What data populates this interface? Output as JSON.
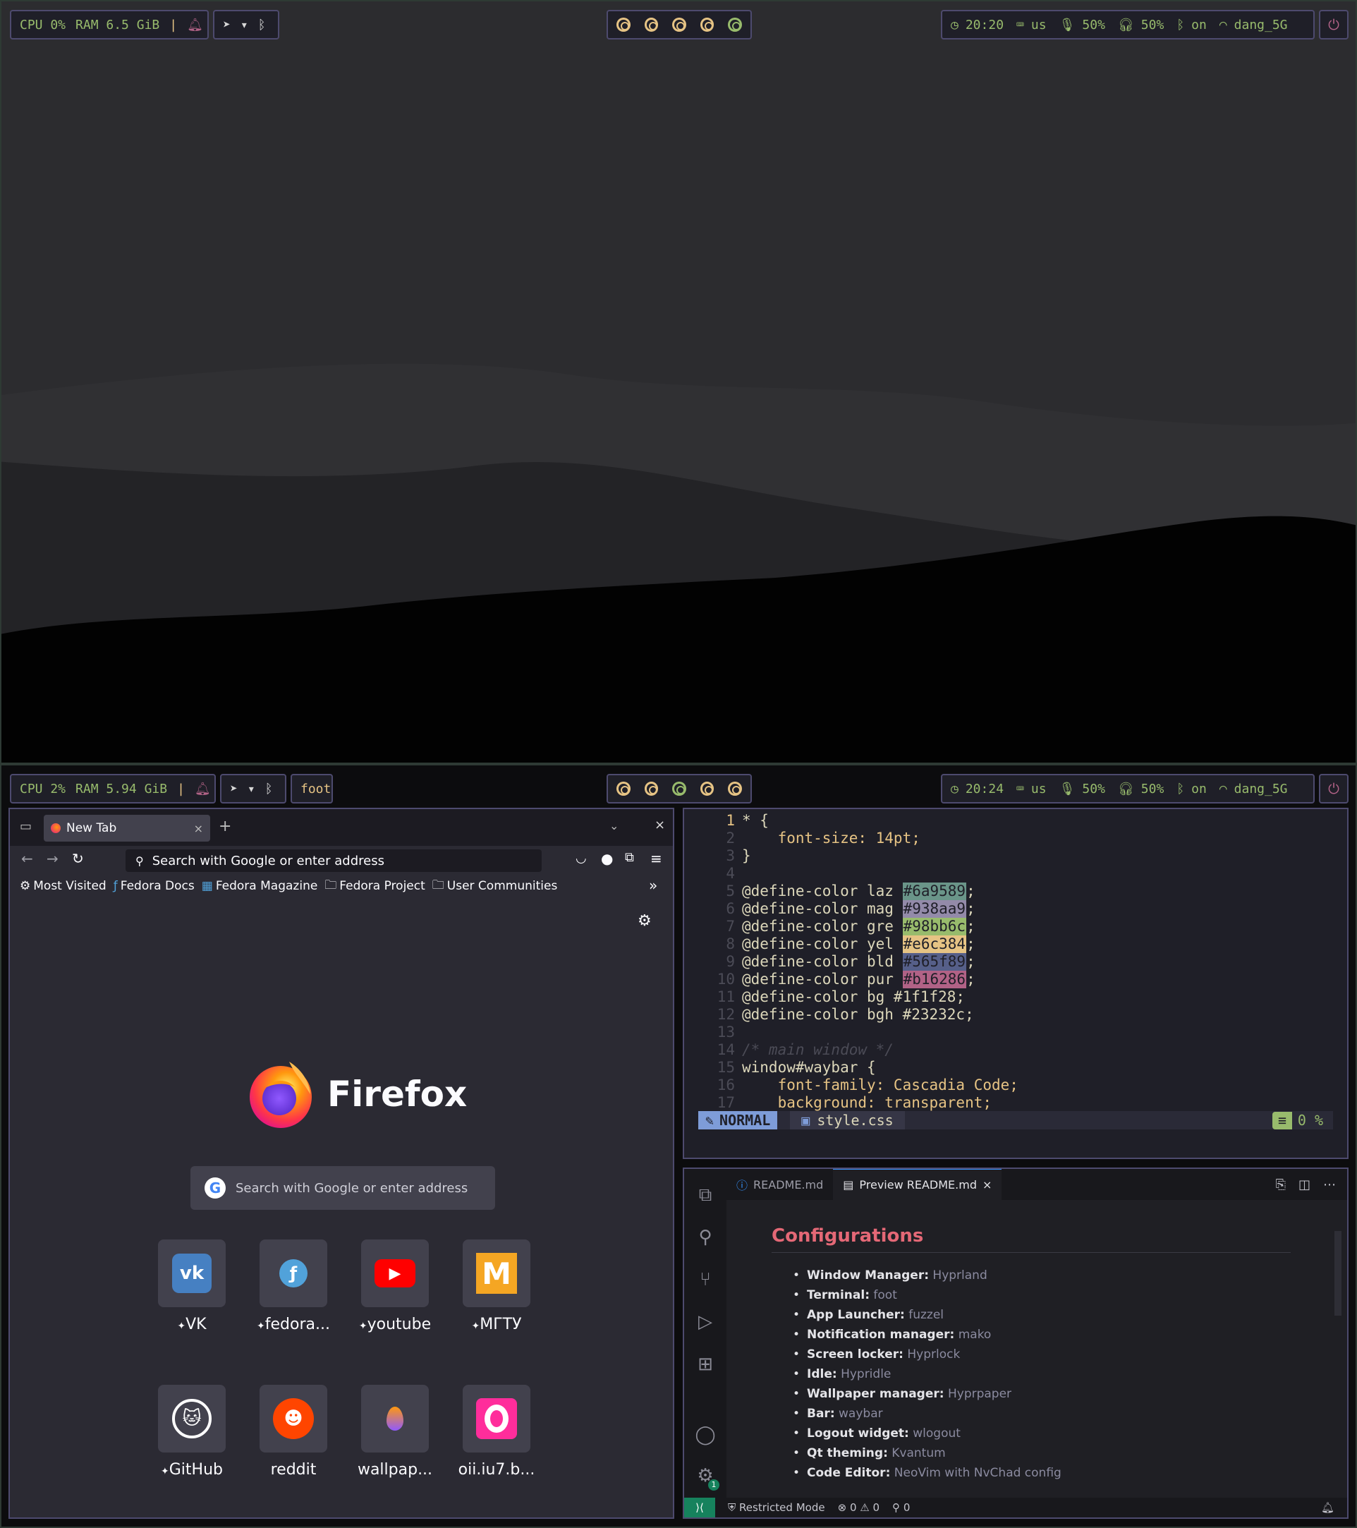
{
  "colors": {
    "bar_bg": "#1f1f28",
    "bar_border": "#4d4a6e",
    "green": "#98bb6c",
    "yellow": "#e6c384",
    "purple": "#b16286",
    "blue": "#565f89"
  },
  "top_bar": {
    "cpu": "CPU 0%",
    "ram": "RAM 6.5 GiB",
    "time": "20:20",
    "layout": "us",
    "mic": "50%",
    "headphones": "50%",
    "bluetooth": "on",
    "wifi": "dang_5G"
  },
  "bottom_bar": {
    "cpu": "CPU 2%",
    "ram": "RAM 5.94 GiB",
    "window": "foot",
    "time": "20:24",
    "layout": "us",
    "mic": "50%",
    "headphones": "50%",
    "bluetooth": "on",
    "wifi": "dang_5G"
  },
  "firefox": {
    "tab_title": "New Tab",
    "url_placeholder": "Search with Google or enter address",
    "bookmarks": [
      "Most Visited",
      "Fedora Docs",
      "Fedora Magazine",
      "Fedora Project",
      "User Communities"
    ],
    "brand": "Firefox",
    "search_placeholder": "Search with Google or enter address",
    "shortcuts": [
      {
        "label": "VK",
        "pinned": true,
        "icon": "vk-icon"
      },
      {
        "label": "fedora...",
        "pinned": true,
        "icon": "fedora-icon"
      },
      {
        "label": "youtube",
        "pinned": true,
        "icon": "youtube-icon"
      },
      {
        "label": "МГТУ",
        "pinned": true,
        "icon": "bmstu-icon"
      },
      {
        "label": "GitHub",
        "pinned": true,
        "icon": "github-icon"
      },
      {
        "label": "reddit",
        "pinned": false,
        "icon": "reddit-icon"
      },
      {
        "label": "wallpap...",
        "pinned": false,
        "icon": "flame-icon"
      },
      {
        "label": "oii.iu7.b...",
        "pinned": false,
        "icon": "o-icon"
      }
    ]
  },
  "nvim": {
    "lines": [
      {
        "n": "1",
        "text": "* {"
      },
      {
        "n": "2",
        "text": "    font-size: 14pt;"
      },
      {
        "n": "3",
        "text": "}"
      },
      {
        "n": "4",
        "text": ""
      },
      {
        "n": "5",
        "text": "@define-color laz ",
        "swatch": "#6a9589"
      },
      {
        "n": "6",
        "text": "@define-color mag ",
        "swatch": "#938aa9"
      },
      {
        "n": "7",
        "text": "@define-color gre ",
        "swatch": "#98bb6c"
      },
      {
        "n": "8",
        "text": "@define-color yel ",
        "swatch": "#e6c384"
      },
      {
        "n": "9",
        "text": "@define-color bld ",
        "swatch": "#565f89"
      },
      {
        "n": "10",
        "text": "@define-color pur ",
        "swatch": "#b16286"
      },
      {
        "n": "11",
        "text": "@define-color bg #1f1f28;"
      },
      {
        "n": "12",
        "text": "@define-color bgh #23232c;"
      },
      {
        "n": "13",
        "text": ""
      },
      {
        "n": "14",
        "text": "/* main window */"
      },
      {
        "n": "15",
        "text": "window#waybar {"
      },
      {
        "n": "16",
        "text": "    font-family: Cascadia Code;"
      },
      {
        "n": "17",
        "text": "    background: transparent;"
      }
    ],
    "mode": "NORMAL",
    "file": "style.css",
    "percent": "0 %"
  },
  "vscode": {
    "tabs": [
      "README.md",
      "Preview README.md"
    ],
    "heading": "Configurations",
    "items": [
      {
        "k": "Window Manager:",
        "v": "Hyprland"
      },
      {
        "k": "Terminal:",
        "v": "foot"
      },
      {
        "k": "App Launcher:",
        "v": "fuzzel"
      },
      {
        "k": "Notification manager:",
        "v": "mako"
      },
      {
        "k": "Screen locker:",
        "v": "Hyprlock"
      },
      {
        "k": "Idle:",
        "v": "Hypridle"
      },
      {
        "k": "Wallpaper manager:",
        "v": "Hyprpaper"
      },
      {
        "k": "Bar:",
        "v": "waybar"
      },
      {
        "k": "Logout widget:",
        "v": "wlogout"
      },
      {
        "k": "Qt theming:",
        "v": "Kvantum"
      },
      {
        "k": "Code Editor:",
        "v": "NeoVim with NvChad config"
      }
    ],
    "status": {
      "mode": "Restricted Mode",
      "errors": "0",
      "warnings": "0",
      "ports": "0",
      "badge": "1"
    }
  }
}
